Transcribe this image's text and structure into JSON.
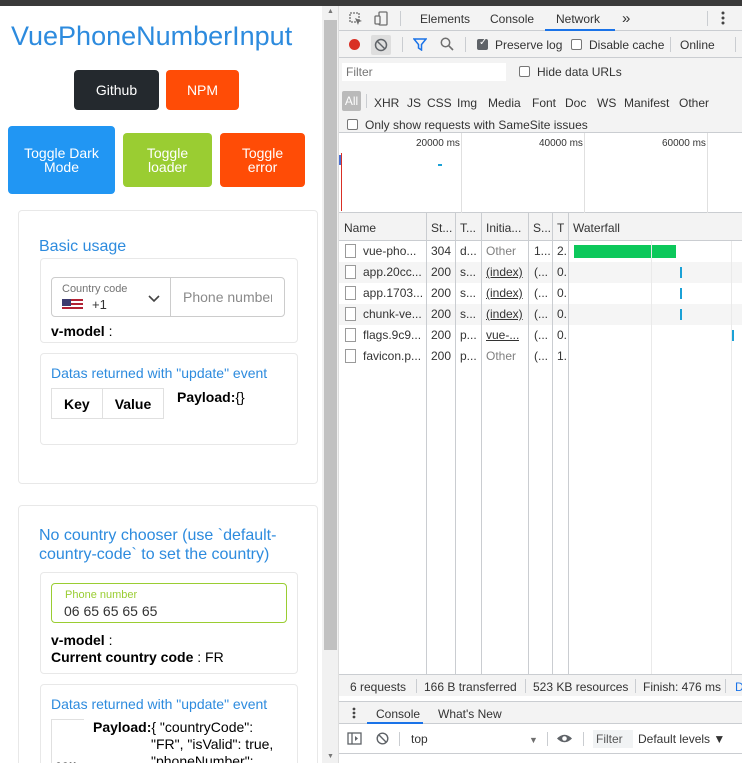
{
  "page": {
    "title": "VuePhoneNumberInput",
    "buttons": {
      "github": "Github",
      "npm": "NPM",
      "toggle_dark": "Toggle Dark Mode",
      "toggle_loader": "Toggle loader",
      "toggle_error": "Toggle error"
    },
    "basic": {
      "title": "Basic usage",
      "country_label": "Country code",
      "country_code": "+1",
      "phone_placeholder": "Phone number",
      "vmodel_label": "v-model",
      "vmodel_sep": " :",
      "update_title": "Datas returned with \"update\" event",
      "table_headers": [
        "Key",
        "Value"
      ],
      "payload_label": "Payload:",
      "payload_value": "{}"
    },
    "no_country": {
      "title": "No country chooser (use `default-country-code` to set the country)",
      "field_label": "Phone number",
      "field_value": "06 65 65 65 65",
      "vmodel_label": "v-model",
      "vmodel_sep": " :",
      "current_label": "Current country code",
      "current_value": " : FR",
      "update_title": "Datas returned with \"update\" event",
      "payload_label": "Payload:",
      "payload_lines": [
        "{ \"countryCode\":",
        "\"FR\", \"isValid\": true,",
        "\"phoneNumber\":"
      ],
      "table_partial": "cou"
    }
  },
  "devtools": {
    "tabs": [
      "Elements",
      "Console",
      "Network"
    ],
    "active_tab": "Network",
    "more": "»",
    "toolbar": {
      "preserve_log": "Preserve log",
      "preserve_log_checked": true,
      "disable_cache": "Disable cache",
      "disable_cache_checked": false,
      "throttle": "Online"
    },
    "filter": {
      "placeholder": "Filter",
      "hide_data_urls": "Hide data URLs",
      "types": [
        "All",
        "XHR",
        "JS",
        "CSS",
        "Img",
        "Media",
        "Font",
        "Doc",
        "WS",
        "Manifest",
        "Other"
      ],
      "samesite": "Only show requests with SameSite issues"
    },
    "overview_labels": [
      "20000 ms",
      "40000 ms",
      "60000 ms"
    ],
    "columns": [
      "Name",
      "St...",
      "T...",
      "Initia...",
      "S...",
      "T",
      "Waterfall"
    ],
    "rows": [
      {
        "name": "vue-pho...",
        "status": "304",
        "type": "d...",
        "initiator": "Other",
        "size": "1...",
        "time": "2."
      },
      {
        "name": "app.20cc...",
        "status": "200",
        "type": "s...",
        "initiator": "(index)",
        "size": "(...",
        "time": "0."
      },
      {
        "name": "app.1703...",
        "status": "200",
        "type": "s...",
        "initiator": "(index)",
        "size": "(...",
        "time": "0."
      },
      {
        "name": "chunk-ve...",
        "status": "200",
        "type": "s...",
        "initiator": "(index)",
        "size": "(...",
        "time": "0."
      },
      {
        "name": "flags.9c9...",
        "status": "200",
        "type": "p...",
        "initiator": "vue-...",
        "size": "(...",
        "time": "0."
      },
      {
        "name": "favicon.p...",
        "status": "200",
        "type": "p...",
        "initiator": "Other",
        "size": "(...",
        "time": "1."
      }
    ],
    "status": {
      "requests": "6 requests",
      "transferred": "166 B transferred",
      "resources": "523 KB resources",
      "finish": "Finish: 476 ms",
      "trailing": "D"
    },
    "drawer": {
      "tabs": [
        "Console",
        "What's New"
      ],
      "context": "top",
      "filter": "Filter",
      "levels": "Default levels ▼"
    },
    "colors": {
      "accent": "#1a73e8",
      "waterfall_green": "#0cc85b",
      "waterfall_blue": "#1ba1d6",
      "record_red": "#d93025"
    }
  }
}
